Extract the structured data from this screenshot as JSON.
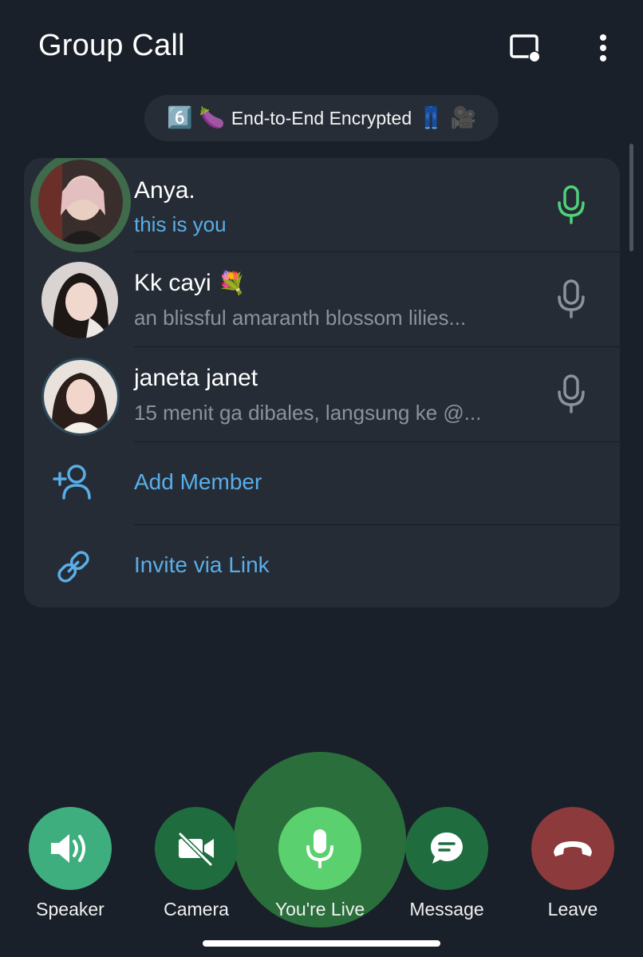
{
  "header": {
    "title": "Group Call"
  },
  "encryption_badge": {
    "label": "End-to-End Encrypted",
    "emojis_left": [
      "6️⃣",
      "🍆"
    ],
    "emojis_right": [
      "👖",
      "🎥"
    ]
  },
  "participants": [
    {
      "name": "Anya.",
      "status": "this is you",
      "mic": "active"
    },
    {
      "name": "Kk cayi",
      "name_emoji": "💐",
      "status": "an blissful amaranth blossom lilies...",
      "mic": "idle"
    },
    {
      "name": "janeta janet",
      "status": "15 menit ga dibales, langsung ke @...",
      "mic": "idle"
    }
  ],
  "actions": {
    "add_member": "Add Member",
    "invite_link": "Invite via Link"
  },
  "controls": {
    "speaker": "Speaker",
    "camera": "Camera",
    "live": "You're Live",
    "message": "Message",
    "leave": "Leave"
  },
  "colors": {
    "background": "#1a2029",
    "panel": "#252c36",
    "accent_blue": "#5aaee8",
    "mic_active": "#4fd179",
    "speaker_btn": "#3fae7f",
    "camera_btn": "#1f6d3f",
    "live_btn": "#5bd06e",
    "message_btn": "#1f6d3f",
    "leave_btn": "#8c3a3c"
  }
}
